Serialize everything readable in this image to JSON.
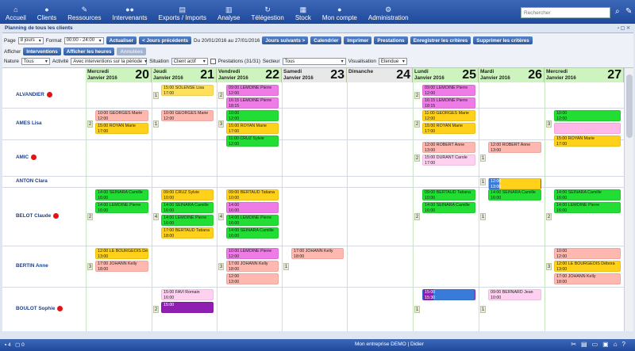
{
  "nav": [
    {
      "label": "Accueil",
      "icon": "home-icon",
      "glyph": "⌂"
    },
    {
      "label": "Clients",
      "icon": "person-icon",
      "glyph": "●"
    },
    {
      "label": "Ressources",
      "icon": "wrench-icon",
      "glyph": "✎"
    },
    {
      "label": "Intervenants",
      "icon": "people-icon",
      "glyph": "●●"
    },
    {
      "label": "Exports / Imports",
      "icon": "document-icon",
      "glyph": "▤"
    },
    {
      "label": "Analyse",
      "icon": "chart-icon",
      "glyph": "▥"
    },
    {
      "label": "Télégestion",
      "icon": "sync-icon",
      "glyph": "↻"
    },
    {
      "label": "Stock",
      "icon": "calculator-icon",
      "glyph": "▦"
    },
    {
      "label": "Mon compte",
      "icon": "user-icon",
      "glyph": "●"
    },
    {
      "label": "Administration",
      "icon": "gear-icon",
      "glyph": "⚙"
    }
  ],
  "search": {
    "placeholder": "Rechercher"
  },
  "titlebar": {
    "title": "Planning de tous les clients"
  },
  "toolbar": {
    "page_label": "Page",
    "page_value": "8 jours",
    "format_label": "Format",
    "format_value": "00:00 - 24:00",
    "refresh": "Actualiser",
    "prev": "< Jours précédents",
    "range": "Du 20/01/2016 au 27/01/2016",
    "next": "Jours suivants >",
    "calendar": "Calendrier",
    "print": "Imprimer",
    "prestations": "Prestations",
    "save_criteria": "Enregistrer les critères",
    "delete_criteria": "Supprimer les critères",
    "afficher_label": "Afficher",
    "interventions": "Interventions",
    "show_hours": "Afficher les heures",
    "cancelled": "Annulées",
    "nature_label": "Nature",
    "nature_value": "Tous",
    "activity_label": "Activité",
    "activity_value": "Avec interventions sur la période",
    "situation_label": "Situation",
    "situation_value": "Client actif",
    "prestations_count": "Prestations (31/31)",
    "sector_label": "Secteur",
    "sector_value": "Tous",
    "visu_label": "Visualisation",
    "visu_value": "Etendue"
  },
  "days": [
    {
      "name": "Mercredi",
      "month": "Janvier 2016",
      "num": "20",
      "we": false
    },
    {
      "name": "Jeudi",
      "month": "Janvier 2016",
      "num": "21",
      "we": false
    },
    {
      "name": "Vendredi",
      "month": "Janvier 2016",
      "num": "22",
      "we": false
    },
    {
      "name": "Samedi",
      "month": "Janvier 2016",
      "num": "23",
      "we": true
    },
    {
      "name": "Dimanche",
      "month": "",
      "num": "24",
      "we": true
    },
    {
      "name": "Lundi",
      "month": "Janvier 2016",
      "num": "25",
      "we": false
    },
    {
      "name": "Mardi",
      "month": "Janvier 2016",
      "num": "26",
      "we": false
    },
    {
      "name": "Mercredi",
      "month": "Janvier 2016",
      "num": "27",
      "we": false
    }
  ],
  "clients": [
    {
      "name": "ALVANDIER",
      "dot": true,
      "counts": {
        "1": "1",
        "2": "2",
        "5": "2"
      },
      "slots": [
        {
          "d": 1,
          "r": 0,
          "start": "15:00",
          "text": "SOLENSE Lisa",
          "end": "17:00",
          "color": "#ffe05a"
        },
        {
          "d": 2,
          "r": 0,
          "start": "09:00",
          "text": "LEMOINE Pierre",
          "end": "12:00",
          "color": "#ee7be6"
        },
        {
          "d": 2,
          "r": 1,
          "start": "16:15",
          "text": "LEMOINE Pierre",
          "end": "18:15",
          "color": "#ee7be6"
        },
        {
          "d": 5,
          "r": 0,
          "start": "09:00",
          "text": "LEMOINE Pierre",
          "end": "12:00",
          "color": "#ee7be6"
        },
        {
          "d": 5,
          "r": 1,
          "start": "16:15",
          "text": "LEMOINE Pierre",
          "end": "18:15",
          "color": "#ee7be6"
        }
      ]
    },
    {
      "name": "AMES Lisa",
      "dot": false,
      "counts": {
        "0": "2",
        "1": "1",
        "2": "3",
        "5": "2",
        "7": "3"
      },
      "slots": [
        {
          "d": 0,
          "r": 0,
          "start": "10:00",
          "text": "GEORGES Marie",
          "end": "12:00",
          "color": "#ffb8b0"
        },
        {
          "d": 0,
          "r": 1,
          "start": "15:00",
          "text": "ROYAN Marie",
          "end": "17:00",
          "color": "#ffd11a"
        },
        {
          "d": 1,
          "r": 0,
          "start": "10:00",
          "text": "GEORGES Marie",
          "end": "12:00",
          "color": "#ffb8b0"
        },
        {
          "d": 2,
          "r": 0,
          "start": "10:00",
          "text": "",
          "end": "12:00",
          "color": "#22dd33"
        },
        {
          "d": 2,
          "r": 1,
          "start": "15:00",
          "text": "ROYAN Marie",
          "end": "17:00",
          "color": "#ffd11a"
        },
        {
          "d": 2,
          "r": 2,
          "start": "11:00",
          "text": "CRUZ Sylvie",
          "end": "12:00",
          "color": "#22dd33"
        },
        {
          "d": 5,
          "r": 0,
          "start": "11:00",
          "text": "GEORGES Marie",
          "end": "12:00",
          "color": "#ffd11a"
        },
        {
          "d": 5,
          "r": 1,
          "start": "15:00",
          "text": "ROYAN Marie",
          "end": "17:00",
          "color": "#ffd11a"
        },
        {
          "d": 7,
          "r": 0,
          "start": "10:00",
          "text": "",
          "end": "12:00",
          "color": "#22dd33"
        },
        {
          "d": 7,
          "r": 1,
          "start": "",
          "text": "",
          "end": "",
          "color": "#ffb8e8"
        },
        {
          "d": 7,
          "r": 2,
          "start": "15:00",
          "text": "ROYAN Marie",
          "end": "17:00",
          "color": "#ffd11a"
        }
      ]
    },
    {
      "name": "AMIC",
      "dot": true,
      "counts": {
        "5": "2",
        "6": "1"
      },
      "slots": [
        {
          "d": 5,
          "r": 0,
          "start": "12:00",
          "text": "ROBERT Anne",
          "end": "13:00",
          "color": "#ffb8b0"
        },
        {
          "d": 5,
          "r": 1,
          "start": "15:00",
          "text": "DURANT Carole",
          "end": "17:00",
          "color": "#ffd0f0"
        },
        {
          "d": 6,
          "r": 0,
          "start": "12:00",
          "text": "ROBERT Anne",
          "end": "13:00",
          "color": "#ffb8b0"
        }
      ]
    },
    {
      "name": "ANTON Clara",
      "dot": false,
      "counts": {
        "6": "1"
      },
      "slots": [
        {
          "d": 6,
          "r": 0,
          "start": "12:00",
          "text": "",
          "end": "13:00",
          "color": "#3a7ad8",
          "split": "#ffd11a"
        }
      ]
    },
    {
      "name": "BELOT Claude",
      "dot": true,
      "counts": {
        "0": "2",
        "1": "4",
        "2": "4",
        "5": "2",
        "6": "1",
        "7": "2"
      },
      "slots": [
        {
          "d": 0,
          "r": 0,
          "start": "14:00",
          "text": "SEINARA Camille",
          "end": "16:00",
          "color": "#22dd33"
        },
        {
          "d": 0,
          "r": 1,
          "start": "14:00",
          "text": "LEMOINE Pierre",
          "end": "16:00",
          "color": "#22dd33"
        },
        {
          "d": 1,
          "r": 0,
          "start": "09:00",
          "text": "CRUZ Sylvie",
          "end": "10:00",
          "color": "#ffd11a"
        },
        {
          "d": 1,
          "r": 1,
          "start": "14:00",
          "text": "SEINARA Camille",
          "end": "16:00",
          "color": "#22dd33"
        },
        {
          "d": 1,
          "r": 2,
          "start": "14:00",
          "text": "LEMOINE Pierre",
          "end": "16:00",
          "color": "#22dd33"
        },
        {
          "d": 1,
          "r": 3,
          "start": "17:00",
          "text": "BERTAUD Tatiana",
          "end": "18:00",
          "color": "#ffd11a"
        },
        {
          "d": 2,
          "r": 0,
          "start": "09:00",
          "text": "BERTAUD Tatiana",
          "end": "10:00",
          "color": "#ffd11a"
        },
        {
          "d": 2,
          "r": 1,
          "start": "14:00",
          "text": "",
          "end": "16:00",
          "color": "#ee7be6"
        },
        {
          "d": 2,
          "r": 2,
          "start": "14:00",
          "text": "LEMOINE Pierre",
          "end": "16:00",
          "color": "#22dd33"
        },
        {
          "d": 2,
          "r": 3,
          "start": "14:00",
          "text": "SEINARA Camille",
          "end": "16:00",
          "color": "#22dd33"
        },
        {
          "d": 5,
          "r": 0,
          "start": "09:00",
          "text": "BERTAUD Tatiana",
          "end": "10:00",
          "color": "#22dd33"
        },
        {
          "d": 5,
          "r": 1,
          "start": "14:00",
          "text": "SEINARA Camille",
          "end": "16:00",
          "color": "#22dd33"
        },
        {
          "d": 6,
          "r": 0,
          "start": "14:00",
          "text": "SEINARA Camille",
          "end": "16:00",
          "color": "#22dd33"
        },
        {
          "d": 7,
          "r": 0,
          "start": "14:00",
          "text": "SEINARA Camille",
          "end": "16:00",
          "color": "#22dd33"
        },
        {
          "d": 7,
          "r": 1,
          "start": "14:00",
          "text": "LEMOINE Pierre",
          "end": "16:00",
          "color": "#22dd33"
        }
      ]
    },
    {
      "name": "BERTIN Anne",
      "dot": false,
      "counts": {
        "0": "3",
        "2": "3",
        "3": "1",
        "7": "3"
      },
      "slots": [
        {
          "d": 0,
          "r": 0,
          "start": "12:00",
          "text": "LE BOURGEOIS Débora",
          "end": "13:00",
          "color": "#ffd11a"
        },
        {
          "d": 0,
          "r": 1,
          "start": "17:00",
          "text": "JOHANN Kelly",
          "end": "18:00",
          "color": "#ffb8b0"
        },
        {
          "d": 2,
          "r": 0,
          "start": "10:00",
          "text": "LEMOINE Pierre",
          "end": "12:00",
          "color": "#ee7be6"
        },
        {
          "d": 2,
          "r": 1,
          "start": "17:00",
          "text": "JOHANN Kelly",
          "end": "18:00",
          "color": "#ffb8b0"
        },
        {
          "d": 2,
          "r": 2,
          "start": "12:00",
          "text": "",
          "end": "13:00",
          "color": "#ffb8b0"
        },
        {
          "d": 3,
          "r": 0,
          "start": "17:00",
          "text": "JOHANN Kelly",
          "end": "18:00",
          "color": "#ffb8b0"
        },
        {
          "d": 7,
          "r": 0,
          "start": "10:00",
          "text": "",
          "end": "12:00",
          "color": "#ffb8b0"
        },
        {
          "d": 7,
          "r": 1,
          "start": "12:00",
          "text": "LE BOURGEOIS Débora",
          "end": "13:00",
          "color": "#ffd11a"
        },
        {
          "d": 7,
          "r": 2,
          "start": "17:00",
          "text": "JOHANN Kelly",
          "end": "18:00",
          "color": "#ffb8b0"
        }
      ]
    },
    {
      "name": "BOULOT Sophie",
      "dot": true,
      "counts": {
        "1": "2",
        "5": "1",
        "6": "1"
      },
      "slots": [
        {
          "d": 1,
          "r": 0,
          "start": "15:00",
          "text": "FAVI Romain",
          "end": "16:00",
          "color": "#ffd0f0"
        },
        {
          "d": 1,
          "r": 1,
          "start": "15:00",
          "text": "",
          "end": "",
          "color": "#8e1fb0"
        },
        {
          "d": 5,
          "r": 0,
          "start": "15:00",
          "text": "",
          "end": "15:30",
          "color": "#8e1fb0",
          "split": "#3a7ad8"
        },
        {
          "d": 6,
          "r": 0,
          "start": "09:00",
          "text": "BERNARD Jean",
          "end": "10:00",
          "color": "#ffd0f0"
        }
      ]
    }
  ],
  "footer": {
    "left": "4",
    "left2": "0",
    "company": "Mon entreprise DEMO | Didier"
  }
}
